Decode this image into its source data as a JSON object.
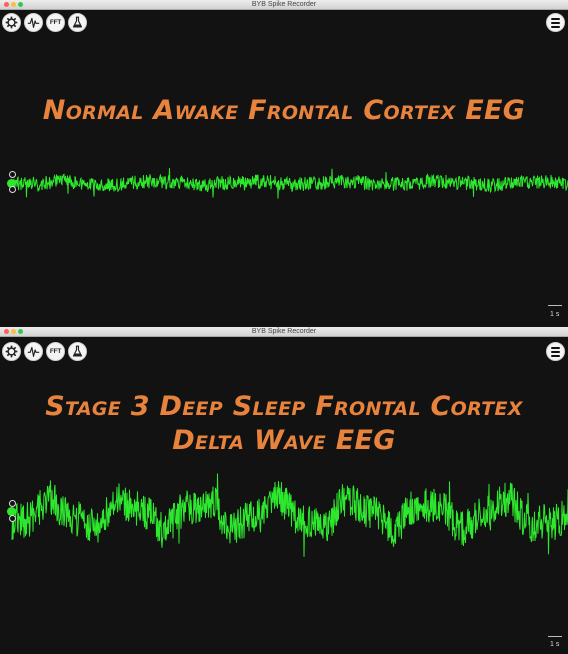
{
  "window_title": "BYB Spike Recorder",
  "toolbar": {
    "settings_icon": "gear-icon",
    "threshold_icon": "spike-waveform-icon",
    "fft_label": "FFT",
    "analysis_icon": "flask-icon"
  },
  "menu_icon": "hamburger-menu-icon",
  "panels": [
    {
      "headline": "Normal Awake Frontal Cortex EEG"
    },
    {
      "headline_line1": "Stage 3 Deep Sleep Frontal Cortex",
      "headline_line2": "Delta Wave EEG"
    }
  ],
  "timescale_label": "1 s",
  "colors": {
    "trace": "#2ee82e",
    "headline": "#e8833d",
    "background": "#121212"
  }
}
